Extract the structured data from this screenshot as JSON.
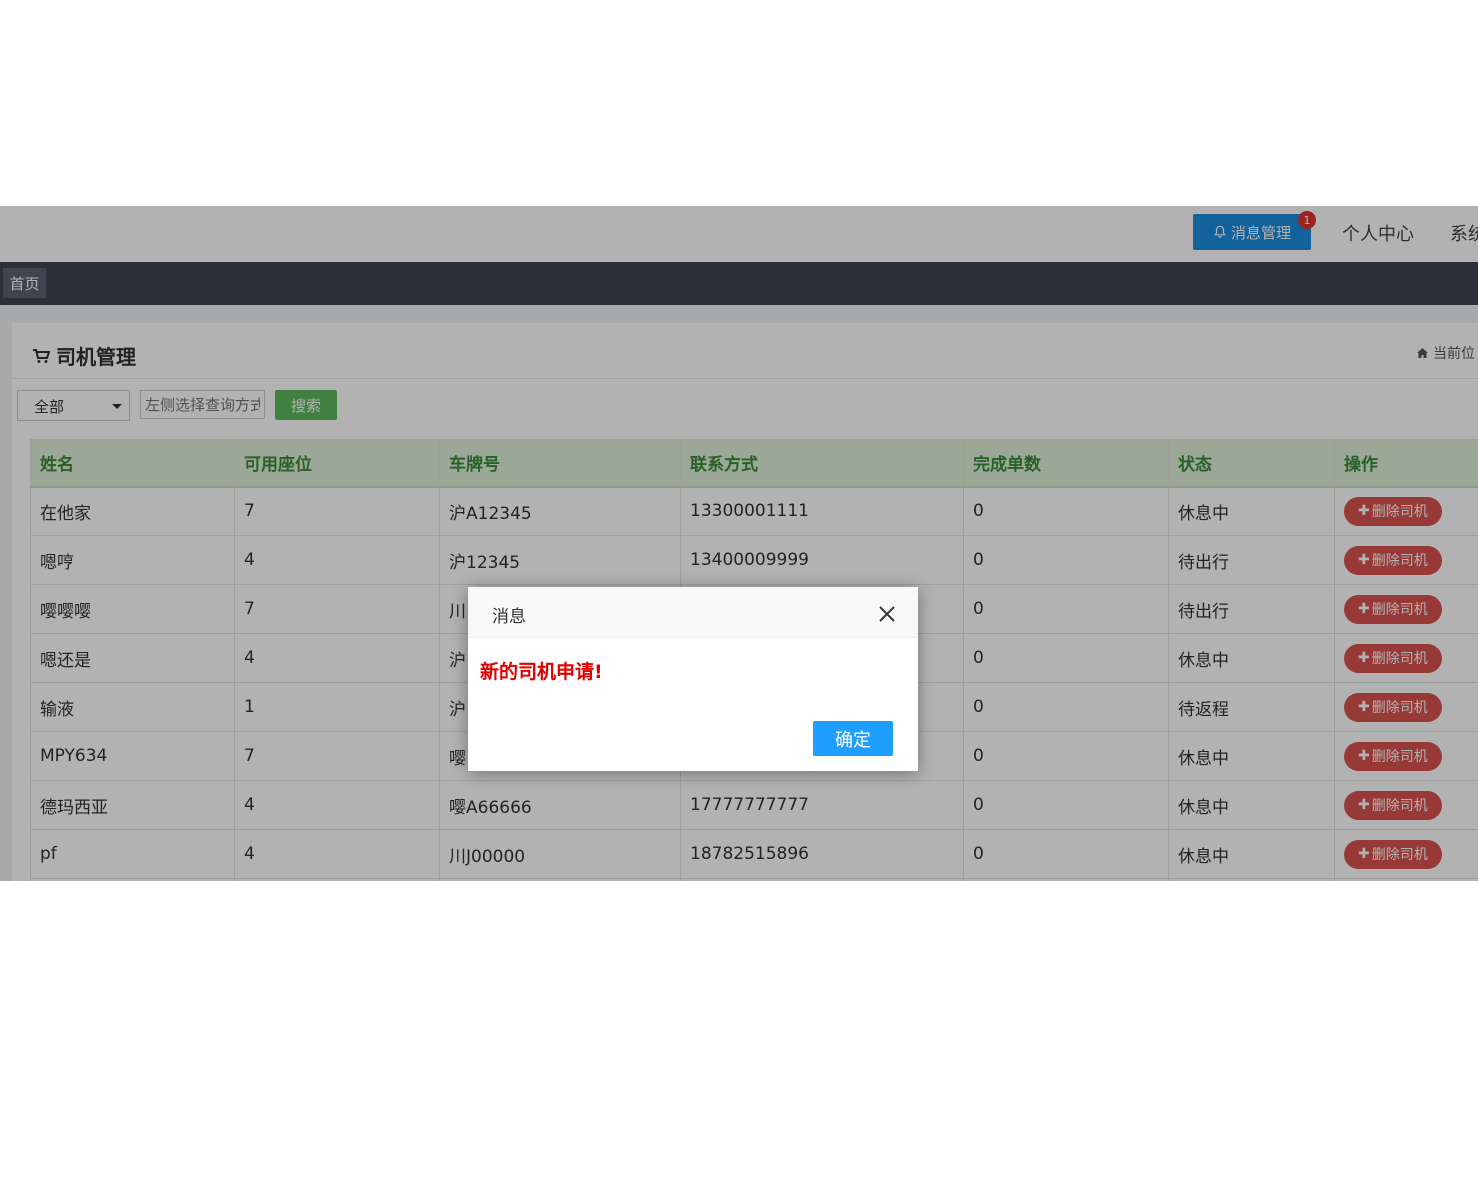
{
  "header": {
    "message_button": "消息管理",
    "message_badge": "1",
    "personal_center": "个人中心",
    "system_link": "系统"
  },
  "tabs": {
    "home": "首页"
  },
  "panel": {
    "title": "司机管理",
    "breadcrumb": "当前位"
  },
  "filter": {
    "select_value": "全部",
    "input_placeholder": "左侧选择查询方式",
    "search_label": "搜索"
  },
  "table": {
    "columns": [
      "姓名",
      "可用座位",
      "车牌号",
      "联系方式",
      "完成单数",
      "状态",
      "操作"
    ],
    "delete_label": "删除司机",
    "rows": [
      [
        "在他家",
        "7",
        "沪A12345",
        "13300001111",
        "0",
        "休息中"
      ],
      [
        "嗯哼",
        "4",
        "沪12345",
        "13400009999",
        "0",
        "待出行"
      ],
      [
        "嘤嘤嘤",
        "7",
        "川",
        "",
        "0",
        "待出行"
      ],
      [
        "嗯还是",
        "4",
        "沪",
        "",
        "0",
        "休息中"
      ],
      [
        "输液",
        "1",
        "沪",
        "",
        "0",
        "待返程"
      ],
      [
        "MPY634",
        "7",
        "嘤",
        "",
        "0",
        "休息中"
      ],
      [
        "德玛西亚",
        "4",
        "嘤A66666",
        "17777777777",
        "0",
        "休息中"
      ],
      [
        "pf",
        "4",
        "川J00000",
        "18782515896",
        "0",
        "休息中"
      ]
    ]
  },
  "dialog": {
    "title": "消息",
    "message": "新的司机申请!",
    "ok_label": "确定"
  },
  "colors": {
    "primary": "#1c8de0",
    "success": "#5cb85c",
    "danger": "#d9534f",
    "nav_dark": "#3b4654",
    "table_header_bg": "#dff0d8",
    "table_header_text": "#3c8b3c",
    "alert_text": "#e00000"
  }
}
